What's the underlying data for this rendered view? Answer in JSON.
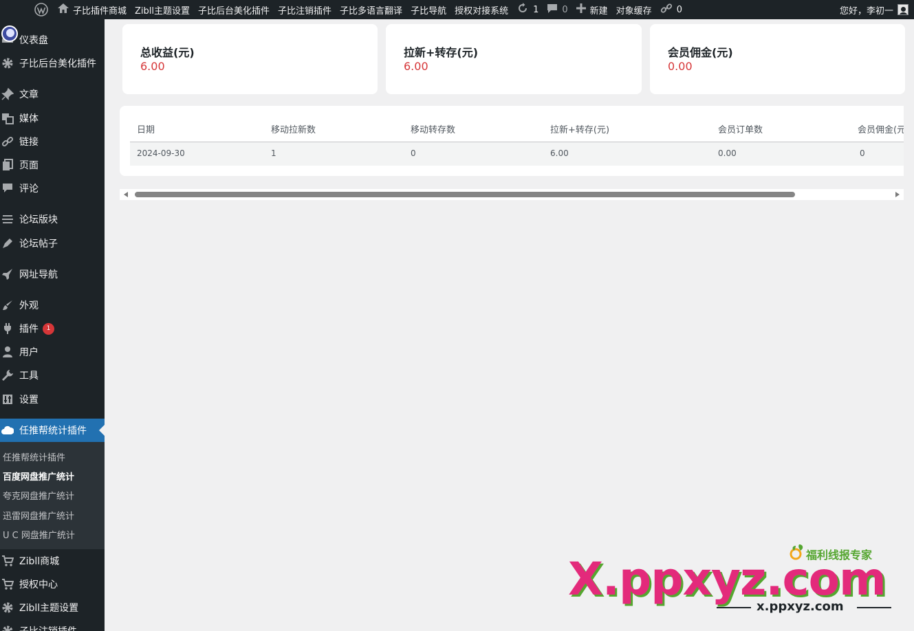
{
  "admin_bar": {
    "items": [
      "子比插件商城",
      "Zibll主题设置",
      "子比后台美化插件",
      "子比注销插件",
      "子比多语言翻译",
      "子比导航",
      "授权对接系统"
    ],
    "updates_count": "1",
    "comments_count": "0",
    "new_label": "新建",
    "cache_label": "对象缓存",
    "links_count": "0",
    "greeting": "您好，李初一"
  },
  "sidebar": {
    "items": [
      {
        "label": "仪表盘",
        "icon": "dashboard-icon"
      },
      {
        "label": "子比后台美化插件",
        "icon": "gear-icon"
      },
      {
        "label": "文章",
        "icon": "pin-icon"
      },
      {
        "label": "媒体",
        "icon": "media-icon"
      },
      {
        "label": "链接",
        "icon": "link-icon"
      },
      {
        "label": "页面",
        "icon": "pages-icon"
      },
      {
        "label": "评论",
        "icon": "comment-icon"
      },
      {
        "label": "论坛版块",
        "icon": "forum-icon"
      },
      {
        "label": "论坛帖子",
        "icon": "post-icon"
      },
      {
        "label": "网址导航",
        "icon": "nav-icon"
      },
      {
        "label": "外观",
        "icon": "brush-icon"
      },
      {
        "label": "插件",
        "icon": "plugin-icon",
        "badge": "1"
      },
      {
        "label": "用户",
        "icon": "user-icon"
      },
      {
        "label": "工具",
        "icon": "wrench-icon"
      },
      {
        "label": "设置",
        "icon": "settings-icon"
      },
      {
        "label": "任推帮统计插件",
        "icon": "cloud-icon",
        "active": true
      },
      {
        "label": "Zibll商城",
        "icon": "cart-icon"
      },
      {
        "label": "授权中心",
        "icon": "cart-icon"
      },
      {
        "label": "Zibll主题设置",
        "icon": "gear-icon"
      },
      {
        "label": "子比注销插件",
        "icon": "gear-icon"
      }
    ],
    "submenu": [
      "任推帮统计插件",
      "百度网盘推广统计",
      "夸克网盘推广统计",
      "迅雷网盘推广统计",
      "U C 网盘推广统计"
    ],
    "submenu_current": "百度网盘推广统计"
  },
  "cards": [
    {
      "label": "总收益(元)",
      "value": "6.00"
    },
    {
      "label": "拉新+转存(元)",
      "value": "6.00"
    },
    {
      "label": "会员佣金(元)",
      "value": "0.00"
    }
  ],
  "table": {
    "headers": [
      "日期",
      "移动拉新数",
      "移动转存数",
      "拉新+转存(元)",
      "会员订单数",
      "会员佣金(元)"
    ],
    "rows": [
      [
        "2024-09-30",
        "1",
        "0",
        "6.00",
        "0.00",
        "0"
      ]
    ]
  },
  "watermark": {
    "brand": "福利线报专家",
    "main": "X.ppxyz.com",
    "sub": "x.ppxyz.com"
  },
  "colors": {
    "admin_bg": "#1d2327",
    "active_blue": "#2271b1",
    "value_red": "#d63638",
    "content_bg": "#f0f0f1"
  }
}
